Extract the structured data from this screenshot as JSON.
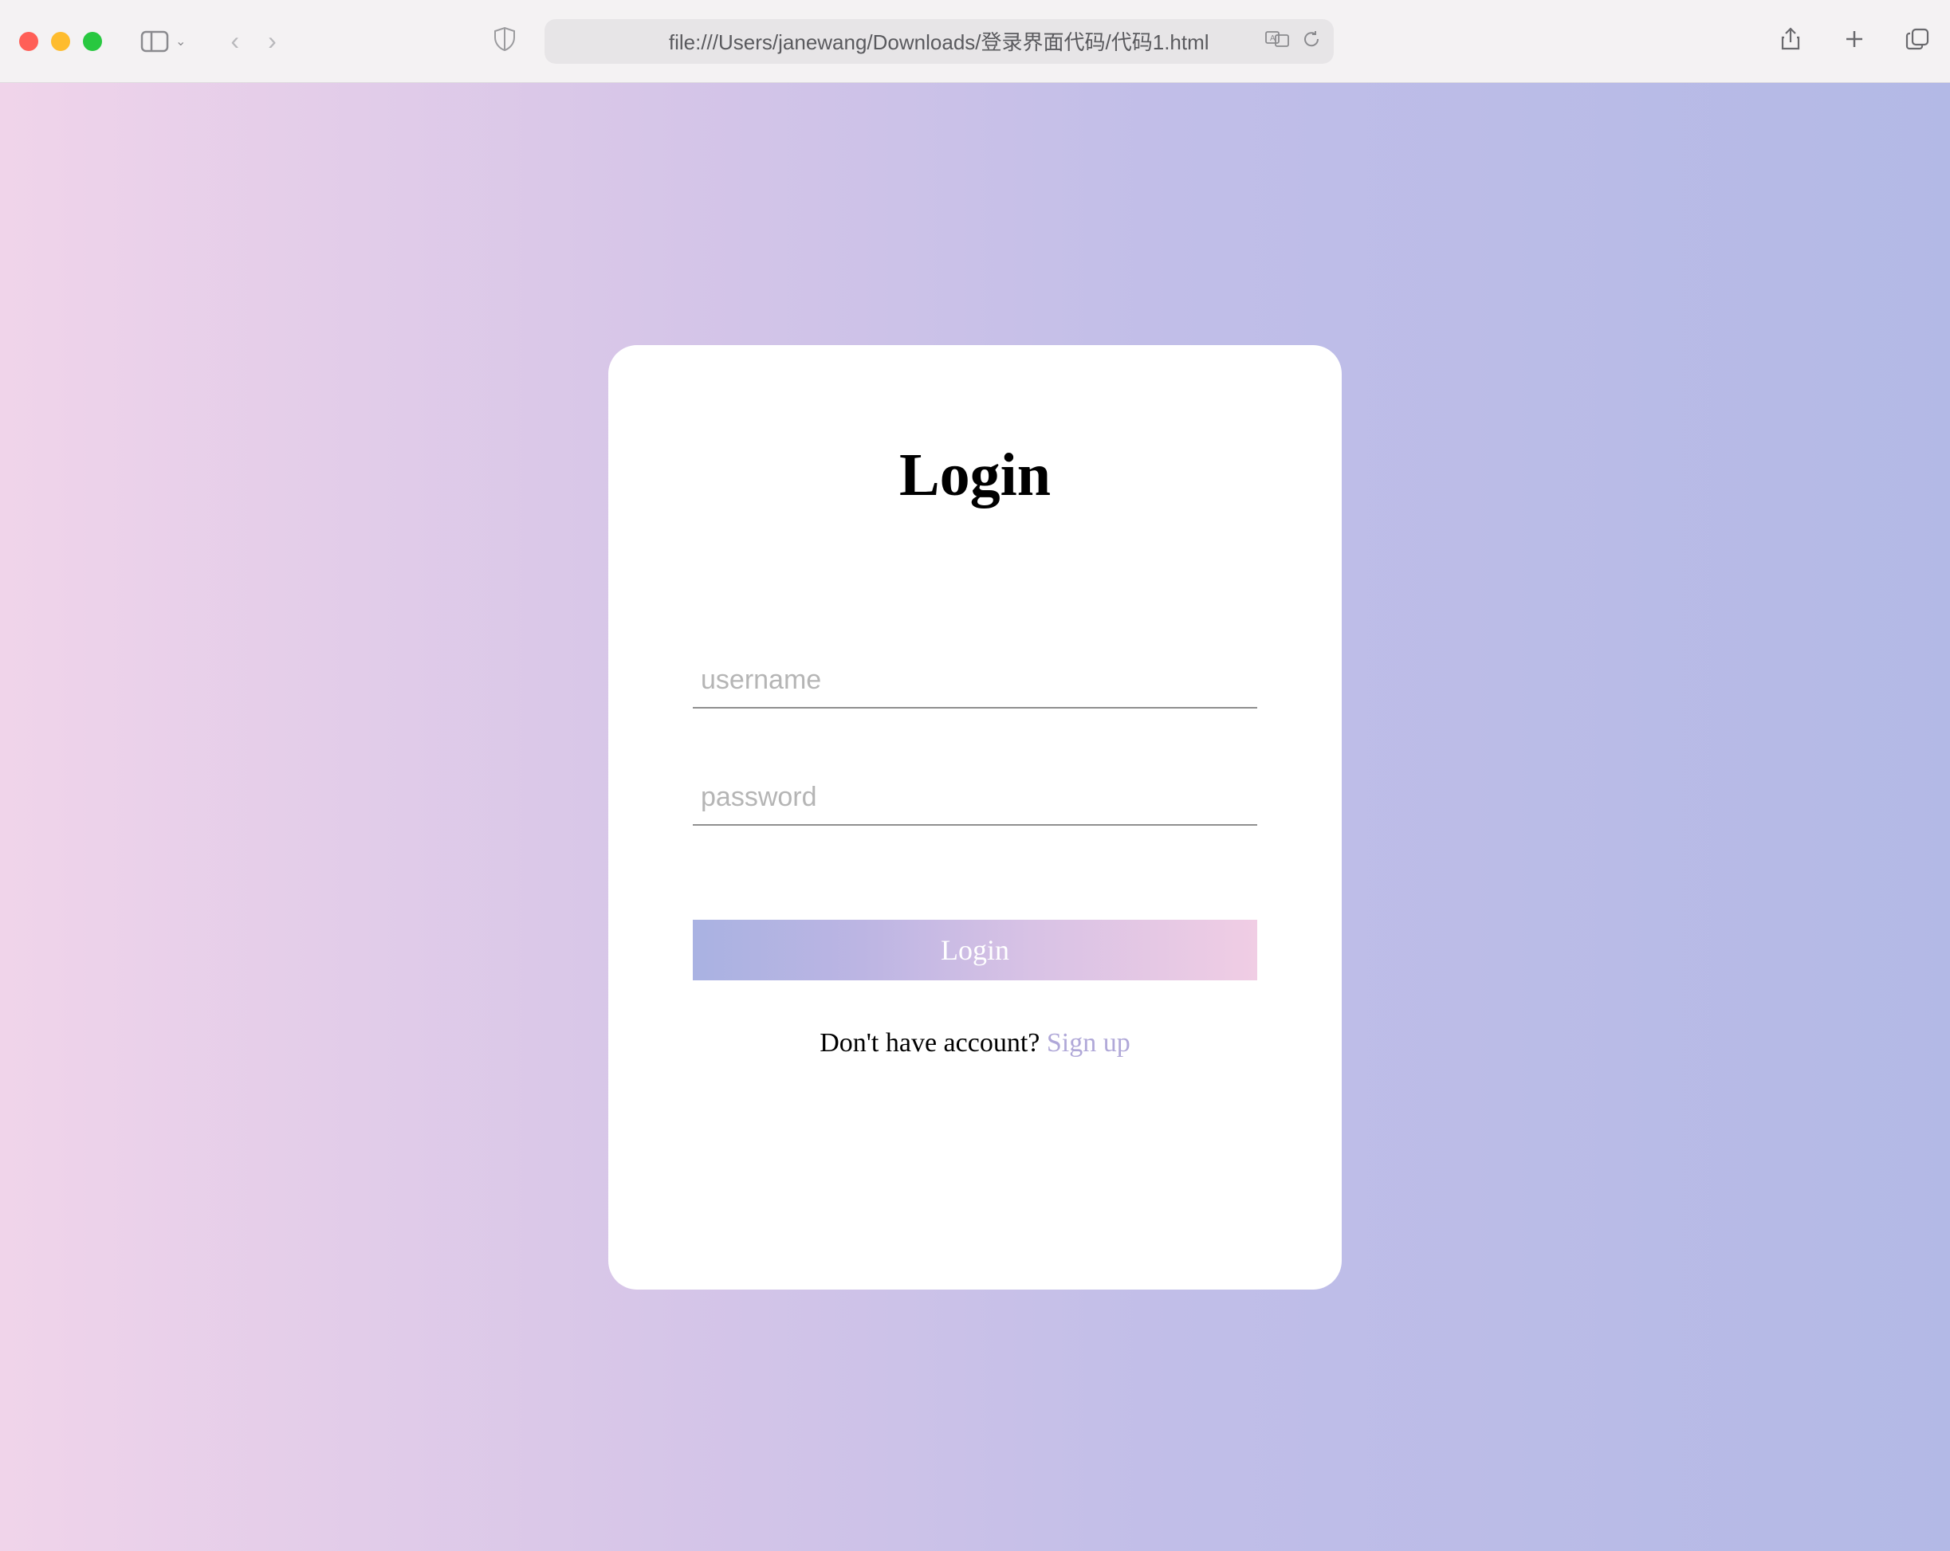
{
  "browser": {
    "url": "file:///Users/janewang/Downloads/登录界面代码/代码1.html"
  },
  "card": {
    "title": "Login",
    "username_placeholder": "username",
    "password_placeholder": "password",
    "button_label": "Login",
    "signup_prompt": "Don't have account? ",
    "signup_link_label": "Sign up"
  }
}
